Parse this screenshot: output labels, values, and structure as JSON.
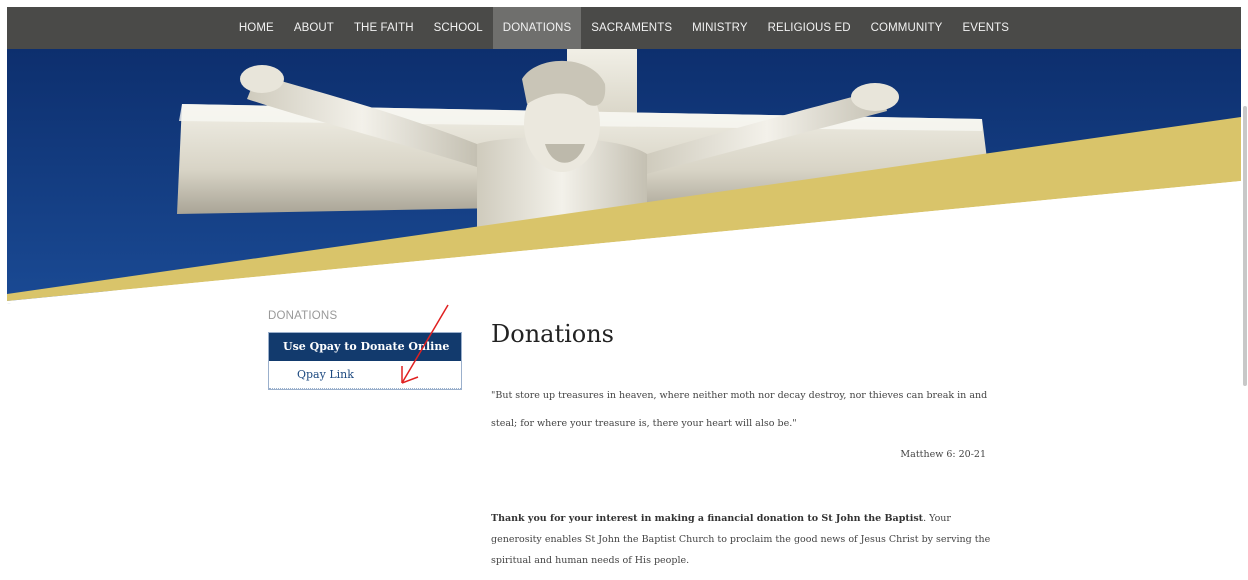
{
  "nav": {
    "items": [
      {
        "label": "HOME"
      },
      {
        "label": "ABOUT"
      },
      {
        "label": "THE FAITH"
      },
      {
        "label": "SCHOOL"
      },
      {
        "label": "DONATIONS",
        "active": true
      },
      {
        "label": "SACRAMENTS"
      },
      {
        "label": "MINISTRY"
      },
      {
        "label": "RELIGIOUS ED"
      },
      {
        "label": "COMMUNITY"
      },
      {
        "label": "EVENTS"
      }
    ]
  },
  "sidebar": {
    "heading": "DONATIONS",
    "active_item": "Use Qpay to Donate Online",
    "link": "Qpay Link"
  },
  "main": {
    "title": "Donations",
    "quote": "\"But store up treasures in heaven, where neither moth nor decay destroy, nor thieves can break in and steal; for where your treasure is, there your heart will also be.\"",
    "citation": "Matthew 6: 20-21",
    "thanks_bold": "Thank you for your interest in making a financial donation to St John the Baptist",
    "thanks_rest": ". Your generosity enables St John the Baptist Church to proclaim the good news of Jesus Christ by serving the spiritual and human needs of His people."
  },
  "colors": {
    "nav_bg": "#4a4a48",
    "nav_active": "#6f6f6d",
    "hero_blue": "#10387a",
    "hero_gold": "#d9c46a",
    "menu_active_bg": "#123a6d",
    "link": "#1e4a80",
    "arrow": "#e02020"
  },
  "icons": {
    "annotation": "red-arrow-icon"
  }
}
